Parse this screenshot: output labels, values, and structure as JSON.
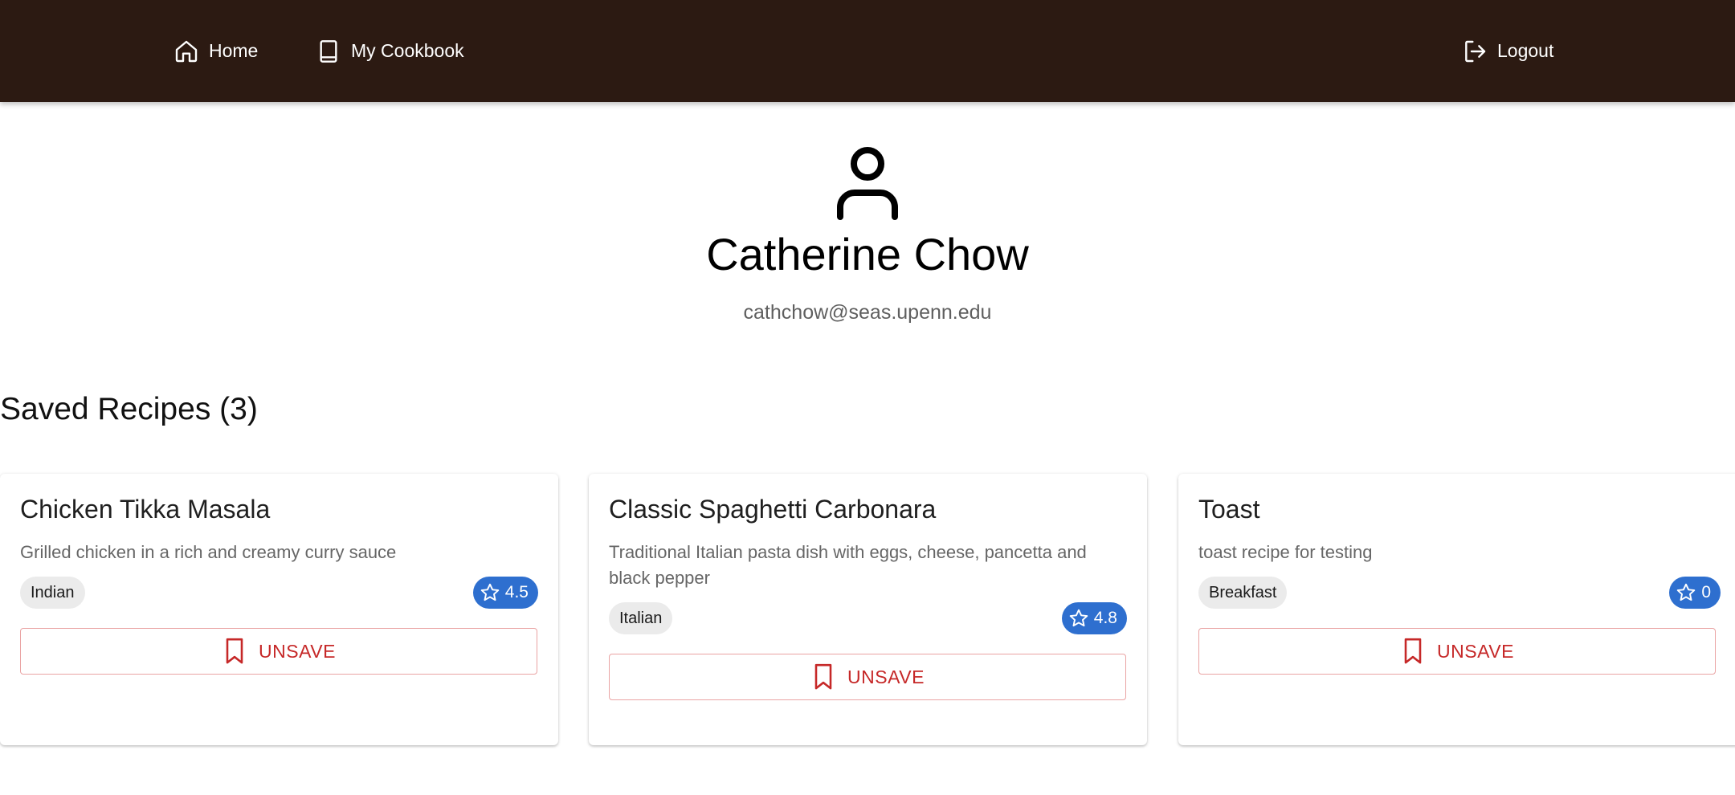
{
  "nav": {
    "home_label": "Home",
    "cookbook_label": "My Cookbook",
    "logout_label": "Logout"
  },
  "profile": {
    "name": "Catherine Chow",
    "email": "cathchow@seas.upenn.edu"
  },
  "saved": {
    "title": "Saved Recipes (3)",
    "recipes": [
      {
        "title": "Chicken Tikka Masala",
        "description": "Grilled chicken in a rich and creamy curry sauce",
        "cuisine": "Indian",
        "rating": "4.5",
        "button": "UNSAVE"
      },
      {
        "title": "Classic Spaghetti Carbonara",
        "description": "Traditional Italian pasta dish with eggs, cheese, pancetta and black pepper",
        "cuisine": "Italian",
        "rating": "4.8",
        "button": "UNSAVE"
      },
      {
        "title": "Toast",
        "description": "toast recipe for testing",
        "cuisine": "Breakfast",
        "rating": "0",
        "button": "UNSAVE"
      }
    ]
  },
  "colors": {
    "navbar": "#2c1a12",
    "accent_blue": "#2e6fcf",
    "danger_red": "#c62828"
  },
  "icons": {
    "home": "home-icon",
    "cookbook": "book-icon",
    "logout": "logout-icon",
    "avatar": "user-icon",
    "rating": "star-icon",
    "unsave": "bookmark-icon"
  }
}
